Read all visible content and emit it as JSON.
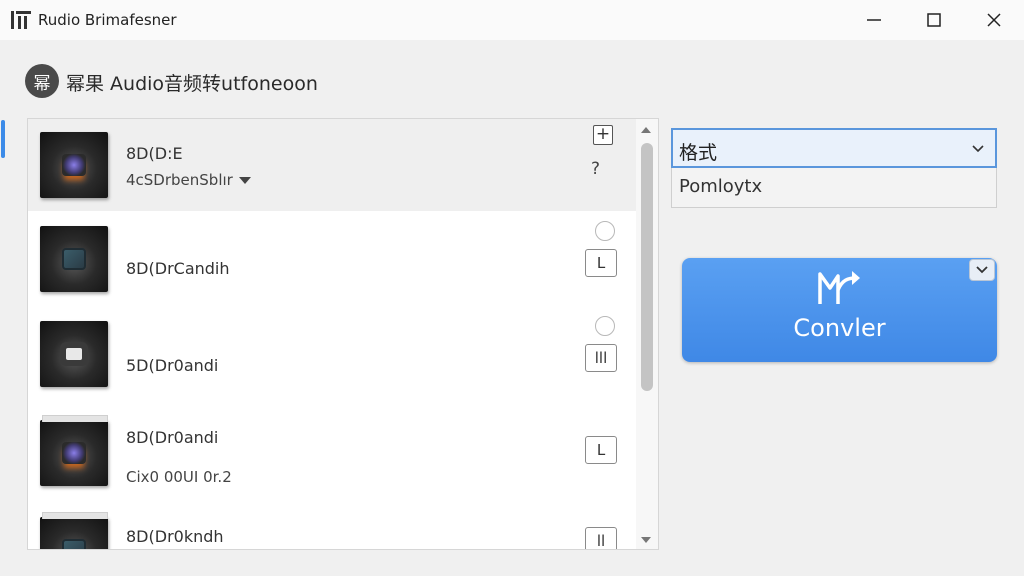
{
  "window": {
    "title": "Rudio Brimafesner",
    "logo_icon": "app-logo-icon",
    "controls": [
      "minimize-icon",
      "maximize-icon",
      "close-icon"
    ]
  },
  "header": {
    "logo_glyph": "幂",
    "title": "幂果 Audio音频转utfoneoon"
  },
  "list": {
    "items": [
      {
        "name": "8D(D:E",
        "sub": "4cSDrbenSblır",
        "has_dropdown": true,
        "selected": true,
        "action": "?",
        "thumb_icon": "audio-disc-icon"
      },
      {
        "name": "8D(DrCandih",
        "sub": "",
        "action": "L",
        "thumb_icon": "equalizer-icon"
      },
      {
        "name": "5D(Dr0andi",
        "sub": "",
        "action": "lll",
        "thumb_icon": "speaker-icon"
      },
      {
        "name": "8D(Dr0andi",
        "sub": "Cix0 00UI 0r.2",
        "action": "L",
        "thumb_icon": "audio-disc-icon"
      },
      {
        "name": "8D(Dr0kndh",
        "sub": "",
        "action": "ll",
        "thumb_icon": "equalizer-icon"
      }
    ],
    "add_label": "+"
  },
  "format": {
    "selected": "格式",
    "option": "Pomloytx"
  },
  "convert": {
    "label": "Convler",
    "icon": "convert-arrow-icon",
    "menu_icon": "chevron-down-icon"
  },
  "colors": {
    "accent": "#3f88e6",
    "select_border": "#5a96dc"
  }
}
